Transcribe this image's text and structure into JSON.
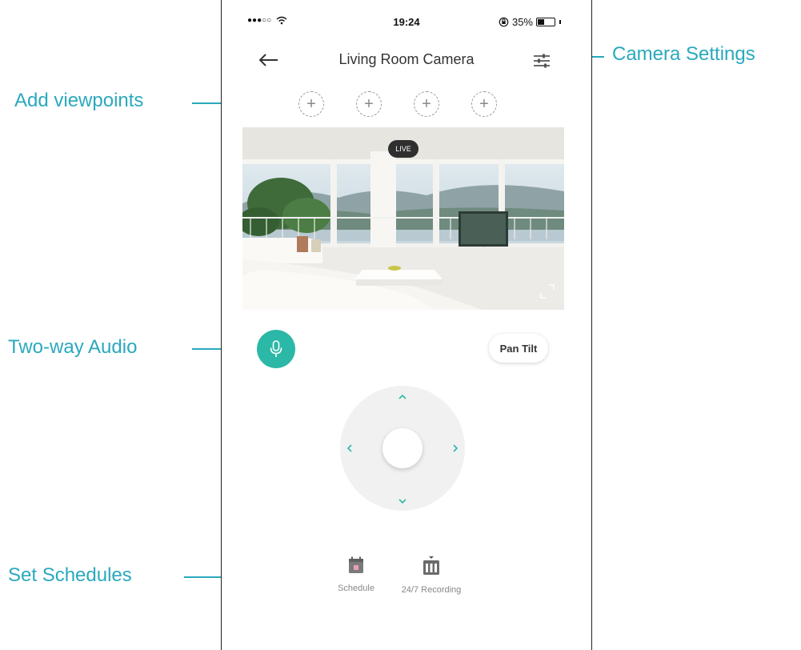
{
  "status_bar": {
    "time": "19:24",
    "battery_text": "35%",
    "battery_level": 0.35
  },
  "nav": {
    "title": "Living Room Camera",
    "back_icon": "arrow-left-icon",
    "settings_icon": "sliders-icon"
  },
  "viewpoints": [
    "+",
    "+",
    "+",
    "+"
  ],
  "video": {
    "live_label": "LIVE"
  },
  "controls": {
    "pan_tilt_label": "Pan Tilt"
  },
  "bottom_nav": [
    {
      "label": "Schedule",
      "icon": "calendar-icon"
    },
    {
      "label": "24/7 Recording",
      "icon": "recording-icon"
    }
  ],
  "annotations": {
    "camera_settings": "Camera Settings",
    "add_viewpoints": "Add viewpoints",
    "two_way_audio": "Two-way Audio",
    "set_schedules": "Set Schedules"
  },
  "colors": {
    "accent": "#2cb8a6",
    "annotation": "#2aa9bd"
  }
}
